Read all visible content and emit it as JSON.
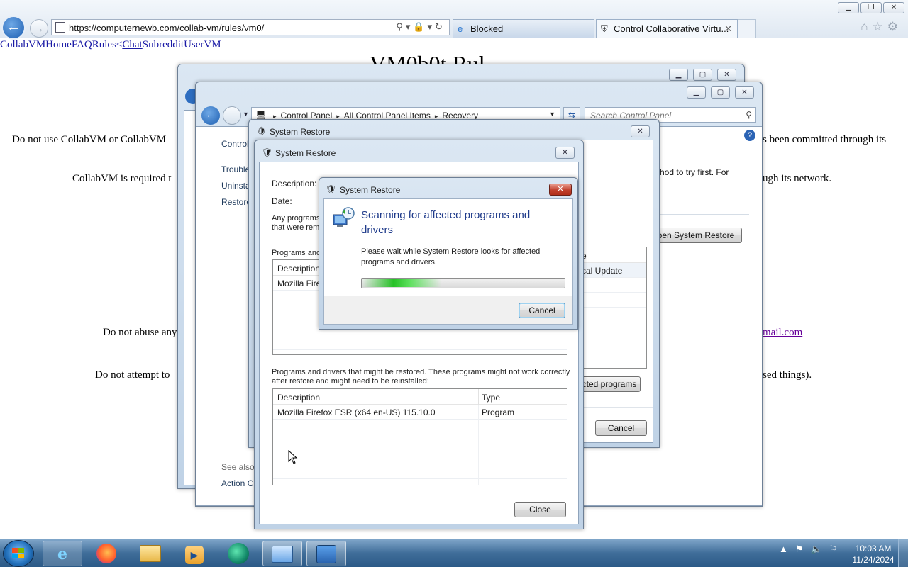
{
  "browser": {
    "url": "https://computernewb.com/collab-vm/rules/vm0/",
    "tabs": [
      {
        "label": "Blocked",
        "icon": "ie-page-icon"
      },
      {
        "label": "Control Collaborative Virtu...",
        "icon": "collabvm-icon"
      }
    ],
    "window_controls": [
      "minimize",
      "maximize",
      "close"
    ]
  },
  "page": {
    "nav": {
      "collabvm": "CollabVM",
      "home": "Home",
      "faq": "FAQ",
      "rules": "Rules",
      "lt": "<",
      "chat": "Chat",
      "subreddit": "Subreddit",
      "uservm": "UserVM"
    },
    "title": "VM0b0t Rul",
    "fragments": {
      "p1_left": "Do not use CollabVM or CollabVM",
      "p1_right": "s been committed through its",
      "p2_left": "CollabVM is required t",
      "p2_right": "ugh its network.",
      "p3_left": "Do not abuse any",
      "p3_link": "mail.com",
      "p4_left": "Do not attempt to",
      "p4_right": "sed things)."
    }
  },
  "control_panel": {
    "breadcrumb": [
      "Control Panel",
      "All Control Panel Items",
      "Recovery"
    ],
    "search_placeholder": "Search Control Panel",
    "side_items": [
      "Control",
      "Trouble",
      "Uninsta",
      "Restore"
    ],
    "see_also": "See also",
    "action_center": "Action C",
    "info_text": "hod to try first. For",
    "open_system_restore": "pen System Restore"
  },
  "sr_back": {
    "title": "System Restore",
    "col_fragment": "e",
    "row_fragment": "cal Update",
    "scan_button": "cted programs",
    "cancel": "Cancel"
  },
  "sr_front": {
    "title": "System Restore",
    "description_label": "Description:",
    "date_label": "Date:",
    "any_programs": "Any programs",
    "that_were": "that were rem",
    "programs_and": "Programs and",
    "table1": {
      "header": "Description",
      "row": "Mozilla Firefox"
    },
    "restored_note_1": "Programs and drivers that might be restored. These programs might not work correctly",
    "restored_note_2": "after restore and might need to be reinstalled:",
    "table2": {
      "headers": [
        "Description",
        "Type"
      ],
      "rows": [
        [
          "Mozilla Firefox ESR (x64 en-US) 115.10.0",
          "Program"
        ]
      ]
    },
    "close": "Close"
  },
  "scan_dialog": {
    "title": "System Restore",
    "heading_1": "Scanning for affected programs and",
    "heading_2": "drivers",
    "message_1": "Please wait while System Restore looks for affected",
    "message_2": "programs and drivers.",
    "progress_state": "indeterminate",
    "cancel": "Cancel"
  },
  "taskbar": {
    "apps": [
      "internet-explorer",
      "firefox",
      "file-explorer",
      "media-player",
      "collabvm-app",
      "control-panel",
      "system-restore"
    ],
    "clock_time": "10:03 AM",
    "clock_date": "11/24/2024"
  }
}
